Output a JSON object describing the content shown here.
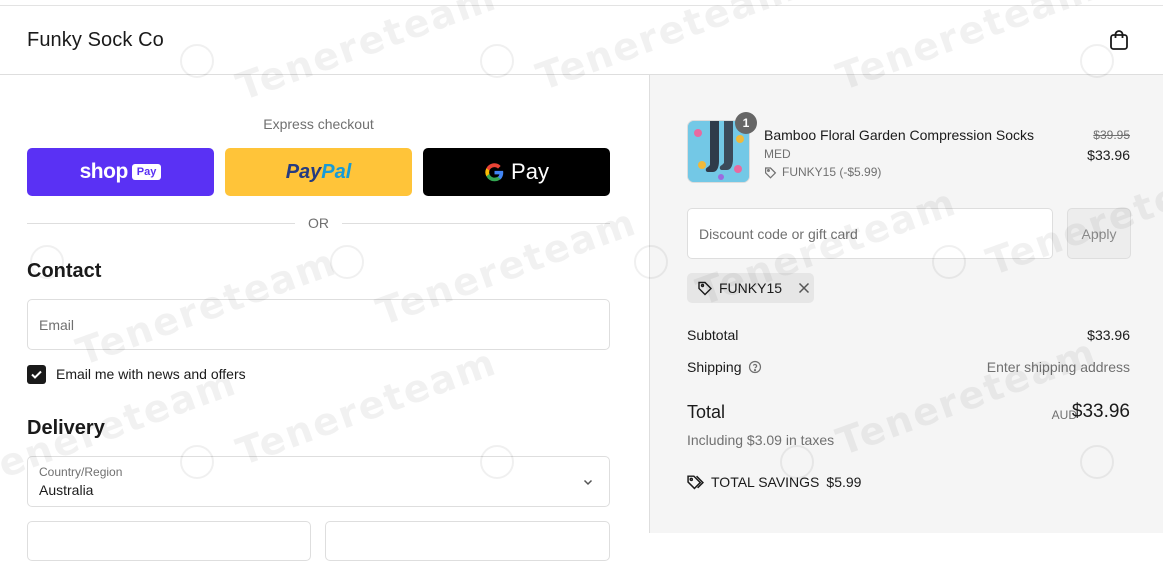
{
  "header": {
    "brand": "Funky Sock Co",
    "cart_icon": "shopping-bag-icon"
  },
  "express": {
    "label": "Express checkout",
    "shop_pay": {
      "word": "shop",
      "badge": "Pay"
    },
    "paypal": {
      "part1": "Pay",
      "part2": "Pal"
    },
    "gpay": {
      "g": "G",
      "word": "Pay"
    },
    "or_label": "OR"
  },
  "contact": {
    "heading": "Contact",
    "email_placeholder": "Email",
    "newsletter_label": "Email me with news and offers",
    "newsletter_checked": true
  },
  "delivery": {
    "heading": "Delivery",
    "country_label": "Country/Region",
    "country_value": "Australia"
  },
  "order": {
    "item": {
      "quantity": "1",
      "name": "Bamboo Floral Garden Compression Socks",
      "variant": "MED",
      "discount": "FUNKY15 (-$5.99)",
      "original_price": "$39.95",
      "price": "$33.96"
    },
    "discount_placeholder": "Discount code or gift card",
    "apply_label": "Apply",
    "applied_code": "FUNKY15",
    "subtotal_label": "Subtotal",
    "subtotal_value": "$33.96",
    "shipping_label": "Shipping",
    "shipping_value": "Enter shipping address",
    "total_label": "Total",
    "currency": "AUD",
    "total_value": "$33.96",
    "tax_note": "Including $3.09 in taxes",
    "savings_label": "TOTAL SAVINGS",
    "savings_value": "$5.99"
  },
  "watermark": {
    "text": "Tenereteam"
  },
  "colors": {
    "shop_pay": "#5a31f4",
    "paypal": "#ffc439",
    "gpay": "#000000",
    "summary_bg": "#f5f5f5"
  }
}
